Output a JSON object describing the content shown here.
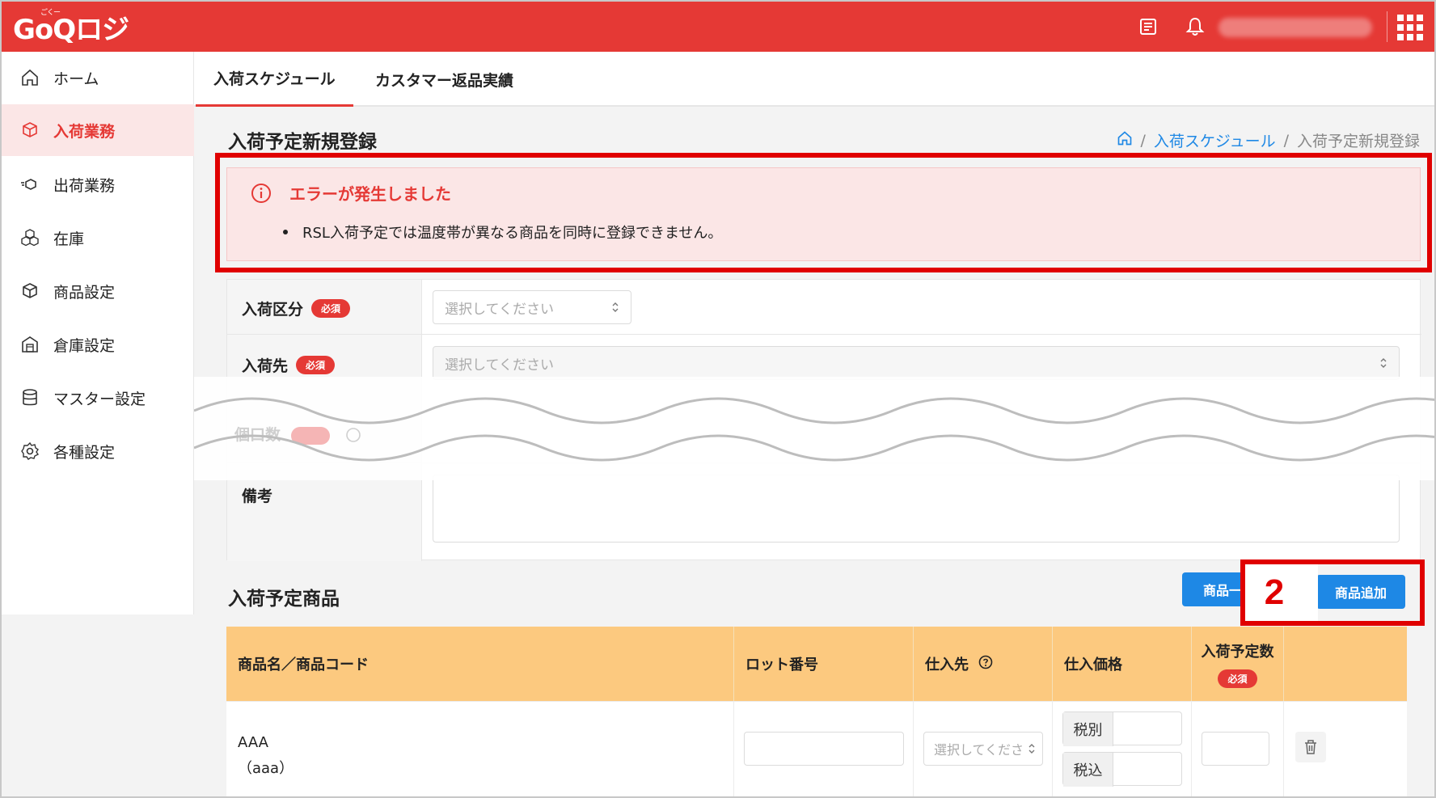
{
  "header": {
    "logo_text": "GoQロジ",
    "logo_ruby": "ごくー",
    "icons": [
      "news-icon",
      "bell-icon",
      "apps-grid-icon"
    ]
  },
  "sidebar": {
    "items": [
      {
        "label": "ホーム",
        "icon": "home-icon"
      },
      {
        "label": "入荷業務",
        "icon": "inbound-box-icon",
        "active": true
      },
      {
        "label": "出荷業務",
        "icon": "outbound-box-icon"
      },
      {
        "label": "在庫",
        "icon": "stock-boxes-icon"
      },
      {
        "label": "商品設定",
        "icon": "product-box-icon"
      },
      {
        "label": "倉庫設定",
        "icon": "warehouse-icon"
      },
      {
        "label": "マスター設定",
        "icon": "database-icon"
      },
      {
        "label": "各種設定",
        "icon": "gear-icon"
      }
    ]
  },
  "tabs": [
    {
      "label": "入荷スケジュール",
      "active": true
    },
    {
      "label": "カスタマー返品実績"
    }
  ],
  "page": {
    "title": "入荷予定新規登録",
    "breadcrumb": {
      "link": "入荷スケジュール",
      "current": "入荷予定新規登録",
      "sep": "/"
    }
  },
  "error": {
    "title": "エラーが発生しました",
    "message": "RSL入荷予定では温度帯が異なる商品を同時に登録できません。"
  },
  "form": {
    "required_badge": "必須",
    "fields": {
      "inbound_type": {
        "label": "入荷区分",
        "placeholder": "選択してください"
      },
      "destination": {
        "label": "入荷先",
        "placeholder": "選択してください"
      },
      "pieces": {
        "label": "個口数"
      },
      "notes": {
        "label": "備考"
      }
    }
  },
  "products": {
    "title": "入荷予定商品",
    "button_partial": "商品一",
    "add_button": "商品追加",
    "annotation_number": "2",
    "columns": {
      "name": "商品名／商品コード",
      "lot": "ロット番号",
      "supplier": "仕入先",
      "price": "仕入価格",
      "qty": "入荷予定数"
    },
    "rows": [
      {
        "name": "AAA",
        "code": "（aaa）",
        "supplier_placeholder": "選択してくださ",
        "price_ex_label": "税別",
        "price_in_label": "税込"
      }
    ]
  },
  "colors": {
    "brand": "#e53935",
    "link": "#1e88e5",
    "table_header": "#fcc97f",
    "annotation": "#e00000"
  }
}
